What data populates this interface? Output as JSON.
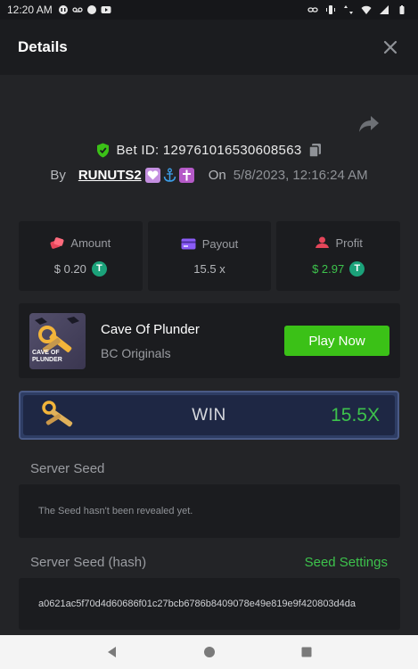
{
  "status_bar": {
    "time": "12:20 AM"
  },
  "header": {
    "title": "Details"
  },
  "bet": {
    "id_label": "Bet ID: 129761016530608563",
    "by_label": "By",
    "username": "RUNUTS2",
    "on_label": "On",
    "date": "5/8/2023, 12:16:24 AM"
  },
  "stats": [
    {
      "label": "Amount",
      "value": "$ 0.20",
      "icon": "chips-icon",
      "currency": "T"
    },
    {
      "label": "Payout",
      "value": "15.5 x",
      "icon": "card-icon"
    },
    {
      "label": "Profit",
      "value": "$ 2.97",
      "icon": "profit-icon",
      "currency": "T"
    }
  ],
  "game": {
    "name": "Cave Of Plunder",
    "provider": "BC Originals",
    "thumb_caption": "CAVE OF PLUNDER",
    "play_label": "Play Now"
  },
  "result": {
    "label": "WIN",
    "multiplier": "15.5X"
  },
  "seeds": {
    "server_seed_label": "Server Seed",
    "server_seed_value": "The Seed hasn't been revealed yet.",
    "hash_label": "Server Seed (hash)",
    "settings_label": "Seed Settings",
    "hash_value": "a0621ac5f70d4d60686f01c27bcb6786b8409078e49e819e9f420803d4da"
  },
  "colors": {
    "accent_green": "#3bc117",
    "profit_green": "#3dc24c",
    "tether": "#1ba27a"
  }
}
